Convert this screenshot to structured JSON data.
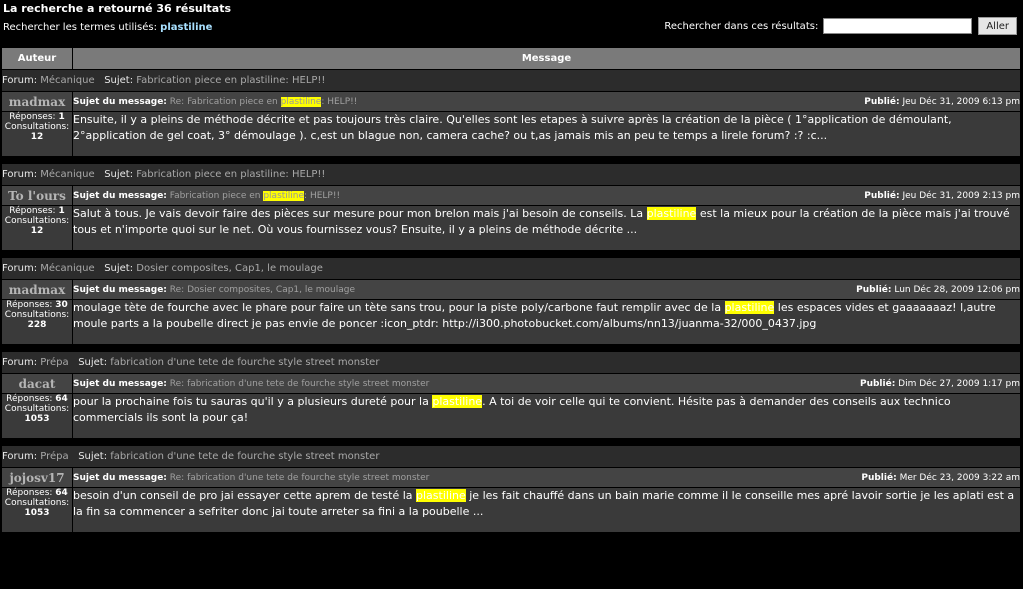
{
  "header": {
    "title": "La recherche a retourné 36 résultats",
    "terms_label": "Rechercher les termes utilisés:",
    "terms_value": "plastiline",
    "search_label": "Rechercher dans ces résultats:",
    "search_value": "",
    "go_label": "Aller"
  },
  "columns": {
    "author": "Auteur",
    "message": "Message"
  },
  "labels": {
    "forum": "Forum:",
    "sujet": "Sujet:",
    "sujet_message": "Sujet du message:",
    "publie": "Publié:",
    "reponses": "Réponses:",
    "consultations": "Consultations:"
  },
  "posts": [
    {
      "forum": "Mécanique",
      "topic": "Fabrication piece en plastiline: HELP!!",
      "author": "madmax",
      "subj_pre": "Re: Fabrication piece en ",
      "subj_hl": "plastiline",
      "subj_post": ": HELP!!",
      "date": "Jeu Déc 31, 2009 6:13 pm",
      "replies": "1",
      "views": "12",
      "msg_pre": "Ensuite, il y a pleins de méthode décrite et pas toujours très claire. Qu'elles sont les etapes à suivre après la création de la pièce ( 1°application de démoulant, 2°application de gel coat, 3° démoulage ). c,est un blague non, camera cache? ou t,as jamais mis an peu te temps a lirele forum? :? :c...",
      "msg_hl": "",
      "msg_post": ""
    },
    {
      "forum": "Mécanique",
      "topic": "Fabrication piece en plastiline: HELP!!",
      "author": "To l'ours",
      "subj_pre": "Fabrication piece en ",
      "subj_hl": "plastiline",
      "subj_post": ": HELP!!",
      "date": "Jeu Déc 31, 2009 2:13 pm",
      "replies": "1",
      "views": "12",
      "msg_pre": "Salut à tous. Je vais devoir faire des pièces sur mesure pour mon brelon mais j'ai besoin de conseils. La ",
      "msg_hl": "plastiline",
      "msg_post": " est la mieux pour la création de la pièce mais j'ai trouvé tous et n'importe quoi sur le net. Où vous fournissez vous? Ensuite, il y a pleins de méthode décrite ..."
    },
    {
      "forum": "Mécanique",
      "topic": "Dosier composites, Cap1, le moulage",
      "author": "madmax",
      "subj_pre": "Re: Dosier composites, Cap1, le moulage",
      "subj_hl": "",
      "subj_post": "",
      "date": "Lun Déc 28, 2009 12:06 pm",
      "replies": "30",
      "views": "228",
      "msg_pre": "moulage tète de fourche avec le phare pour faire un tète sans trou, pour la piste poly/carbone faut remplir avec de la ",
      "msg_hl": "plastiline",
      "msg_post": " les espaces vides et gaaaaaaaz! l,autre moule parts a la poubelle direct je pas envie de poncer :icon_ptdr: http://i300.photobucket.com/albums/nn13/juanma-32/000_0437.jpg"
    },
    {
      "forum": "Prépa",
      "topic": "fabrication d'une tete de fourche style street monster",
      "author": "dacat",
      "subj_pre": "Re: fabrication d'une tete de fourche style street monster",
      "subj_hl": "",
      "subj_post": "",
      "date": "Dim Déc 27, 2009 1:17 pm",
      "replies": "64",
      "views": "1053",
      "msg_pre": "pour la prochaine fois tu sauras qu'il y a plusieurs dureté pour la ",
      "msg_hl": "plastiline",
      "msg_post": ". A toi de voir celle qui te convient. Hésite pas à demander des conseils aux technico commercials ils sont la pour ça!"
    },
    {
      "forum": "Prépa",
      "topic": "fabrication d'une tete de fourche style street monster",
      "author": "jojosv17",
      "subj_pre": "Re: fabrication d'une tete de fourche style street monster",
      "subj_hl": "",
      "subj_post": "",
      "date": "Mer Déc 23, 2009 3:22 am",
      "replies": "64",
      "views": "1053",
      "msg_pre": "besoin d'un conseil de pro jai essayer cette aprem de testé la ",
      "msg_hl": "plastiline",
      "msg_post": " je les fait chauffé dans un bain marie comme il le conseille mes apré lavoir sortie je les aplati est a la fin sa commencer a sefriter donc jai toute arreter sa fini a la poubelle ..."
    }
  ]
}
